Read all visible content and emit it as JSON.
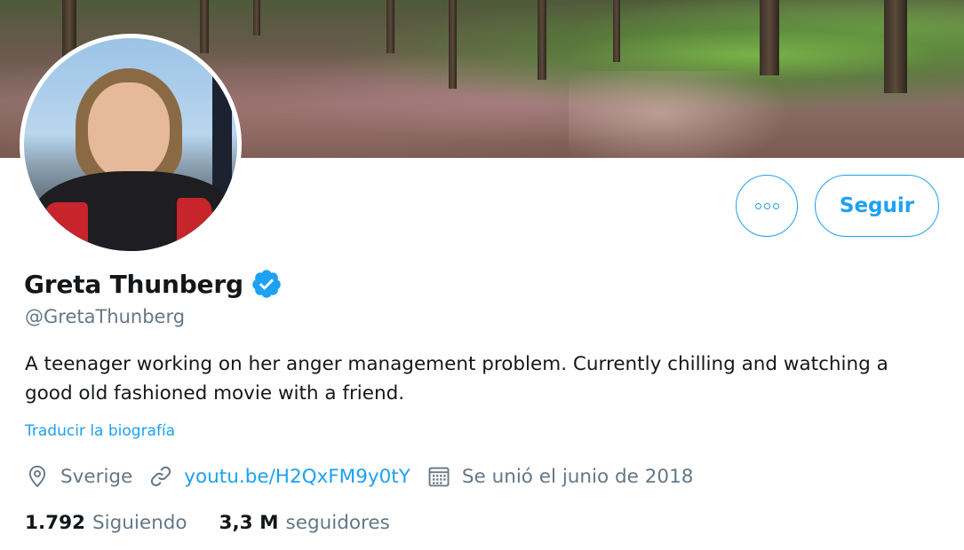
{
  "profile": {
    "name": "Greta Thunberg",
    "handle": "@GretaThunberg",
    "verified": true,
    "bio": "A teenager working on her anger management problem. Currently chilling and watching a good old fashioned movie with a friend.",
    "translate_label": "Traducir la biografía"
  },
  "actions": {
    "more_icon": "more-dots-icon",
    "follow_label": "Seguir"
  },
  "meta": {
    "location": "Sverige",
    "link": "youtu.be/H2QxFM9y0tY",
    "joined": "Se unió el junio de 2018"
  },
  "stats": {
    "following_count": "1.792",
    "following_label": "Siguiendo",
    "followers_count": "3,3 M",
    "followers_label": "seguidores"
  },
  "colors": {
    "accent": "#1da1f2",
    "secondary_text": "#657786",
    "primary_text": "#14171a"
  }
}
